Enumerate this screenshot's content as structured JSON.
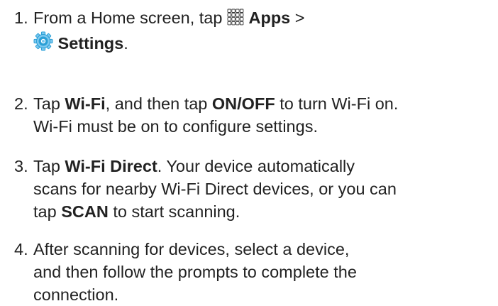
{
  "steps": [
    {
      "number": "1.",
      "line1_text": "From a Home screen, tap",
      "apps_icon": "apps-grid-icon",
      "apps_label": "Apps",
      "separator": ">",
      "settings_icon": "settings-gear-icon",
      "settings_label": "Settings",
      "end_period": "."
    },
    {
      "number": "2.",
      "t1": "Tap ",
      "b1": "Wi-Fi",
      "t2": ", and then tap ",
      "b2": "ON/OFF",
      "t3": " to turn Wi-Fi on.",
      "line2": "Wi-Fi must be on to configure settings."
    },
    {
      "number": "3.",
      "t1": "Tap ",
      "b1": "Wi-Fi Direct",
      "t2": ". Your device automatically",
      "line2": "scans for nearby Wi-Fi Direct devices, or you can",
      "t3": "tap ",
      "b2": "SCAN",
      "t4": " to start scanning."
    },
    {
      "number": "4.",
      "line1": "After scanning for devices, select a device,",
      "line2": "and then follow the prompts to complete the",
      "line3": "connection."
    }
  ],
  "colors": {
    "text": "#222222",
    "settings_icon_blue": "#2a9fd6",
    "settings_icon_light": "#7cc8ef",
    "apps_icon_stroke": "#333333"
  }
}
